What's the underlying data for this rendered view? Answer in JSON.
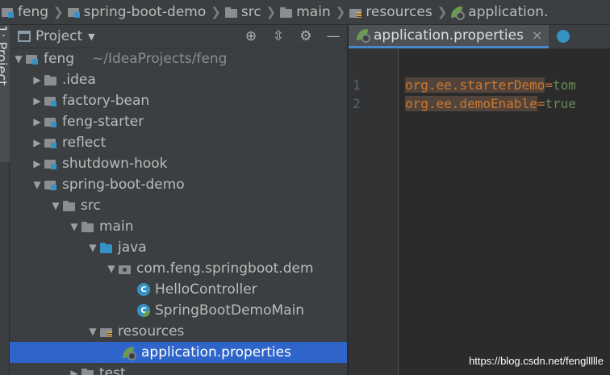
{
  "breadcrumb": [
    {
      "label": "feng",
      "icon": "module-icon"
    },
    {
      "label": "spring-boot-demo",
      "icon": "module-icon"
    },
    {
      "label": "src",
      "icon": "folder-icon"
    },
    {
      "label": "main",
      "icon": "folder-icon"
    },
    {
      "label": "resources",
      "icon": "resources-folder-icon"
    },
    {
      "label": "application.",
      "icon": "spring-config-icon"
    }
  ],
  "toolstrip": {
    "label": "1: Project"
  },
  "panel": {
    "title": "Project"
  },
  "tree": {
    "root": {
      "label": "feng",
      "path": "~/IdeaProjects/feng"
    },
    "idea": "idea",
    "factory_bean": "factory-bean",
    "feng_starter": "feng-starter",
    "reflect": "reflect",
    "shutdown_hook": "shutdown-hook",
    "spring_boot_demo": "spring-boot-demo",
    "src": "src",
    "main": "main",
    "java": "java",
    "package": "com.feng.springboot.dem",
    "hello_controller": "HelloController",
    "main_class": "SpringBootDemoMain",
    "resources": "resources",
    "app_props": "application.properties",
    "test": "test"
  },
  "editor": {
    "tab": {
      "label": "application.properties",
      "close": "×"
    },
    "line_numbers": [
      "1",
      "2"
    ],
    "lines": [
      {
        "key": "org.ee.starterDemo",
        "sep": "=",
        "value": "tom"
      },
      {
        "key": "org.ee.demoEnable",
        "sep": "=",
        "value": "true"
      }
    ]
  },
  "watermark": "https://blog.csdn.net/fengllllle",
  "colors": {
    "background": "#2b2b2b",
    "panel": "#3c3f41",
    "selection": "#2f65ca",
    "key": "#cc7832",
    "value": "#6a8759"
  }
}
